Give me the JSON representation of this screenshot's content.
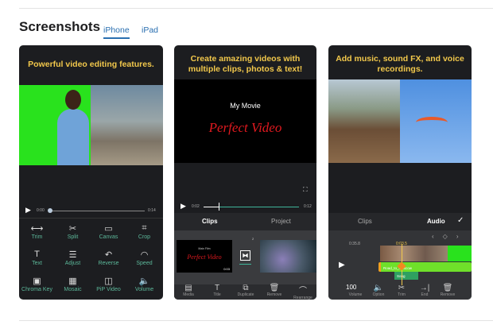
{
  "section": {
    "title": "Screenshots",
    "tabs": [
      {
        "label": "iPhone",
        "active": true
      },
      {
        "label": "iPad",
        "active": false
      }
    ]
  },
  "cards": [
    {
      "caption": "Powerful video editing features.",
      "time_start": "0:00",
      "time_end": "0:14",
      "tools": [
        {
          "label": "Trim",
          "icon": "⟷"
        },
        {
          "label": "Split",
          "icon": "✂"
        },
        {
          "label": "Canvas",
          "icon": "▭"
        },
        {
          "label": "Crop",
          "icon": "⌗"
        },
        {
          "label": "Text",
          "icon": "T"
        },
        {
          "label": "Adjust",
          "icon": "☰"
        },
        {
          "label": "Reverse",
          "icon": "↶"
        },
        {
          "label": "Speed",
          "icon": "◠"
        },
        {
          "label": "Chroma Key",
          "icon": "▣"
        },
        {
          "label": "Mosaic",
          "icon": "▦"
        },
        {
          "label": "PiP Video",
          "icon": "◫"
        },
        {
          "label": "Volume",
          "icon": "🔈"
        }
      ]
    },
    {
      "caption": "Create amazing videos with multiple clips, photos & text!",
      "movie_title": "My Movie",
      "movie_name": "Perfect Video",
      "time_start": "0:02",
      "time_end": "0:12",
      "tabs": [
        "Clips",
        "Project"
      ],
      "clip_title_small": "Main Film",
      "clip_title": "Perfect Video",
      "clip_duration": "0:03",
      "clip_index": "2",
      "toolbar": [
        {
          "label": "Media",
          "icon": "▤"
        },
        {
          "label": "Title",
          "icon": "T"
        },
        {
          "label": "Duplicate",
          "icon": "⧉"
        },
        {
          "label": "Remove",
          "icon": "🗑"
        },
        {
          "label": "Rearrange",
          "icon": "⌒"
        }
      ]
    },
    {
      "caption": "Add music, sound FX, and voice recordings.",
      "tabs": [
        "Clips",
        "Audio"
      ],
      "time_left": "0:35.8",
      "time_current": "0:03.5",
      "audio_track": "Road_to_Moscow",
      "audio_clip": "Song",
      "volume": "100",
      "toolbar": [
        {
          "label": "Volume"
        },
        {
          "label": "Option",
          "icon": "🔈"
        },
        {
          "label": "Trim",
          "icon": "✂"
        },
        {
          "label": "End",
          "icon": "→|"
        },
        {
          "label": "Remove",
          "icon": "🗑"
        }
      ]
    }
  ],
  "colors": {
    "accent": "#2a6fb0",
    "caption": "#f2c84b",
    "teal": "#3fb59a",
    "green_screen": "#29e21d",
    "red_title": "#e0191f"
  }
}
